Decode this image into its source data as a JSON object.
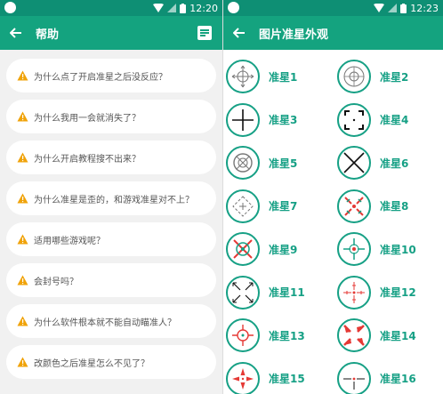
{
  "left": {
    "status_time": "12:20",
    "title": "帮助",
    "faq": [
      "为什么点了开启准星之后没反应？",
      "为什么我用一会就消失了？",
      "为什么开启教程搜不出来？",
      "为什么准星是歪的，和游戏准星对不上？",
      "适用哪些游戏呢？",
      "会封号吗？",
      "为什么软件根本就不能自动瞄准人？",
      "改颜色之后准星怎么不见了？"
    ]
  },
  "right": {
    "status_time": "12:23",
    "title": "图片准星外观",
    "crosshairs": [
      "准星1",
      "准星2",
      "准星3",
      "准星4",
      "准星5",
      "准星6",
      "准星7",
      "准星8",
      "准星9",
      "准星10",
      "准星11",
      "准星12",
      "准星13",
      "准星14",
      "准星15",
      "准星16"
    ]
  },
  "colors": {
    "status": "#0e8f74",
    "appbar": "#14a37f",
    "accent": "#16a085",
    "warning": "#f0a30a"
  }
}
